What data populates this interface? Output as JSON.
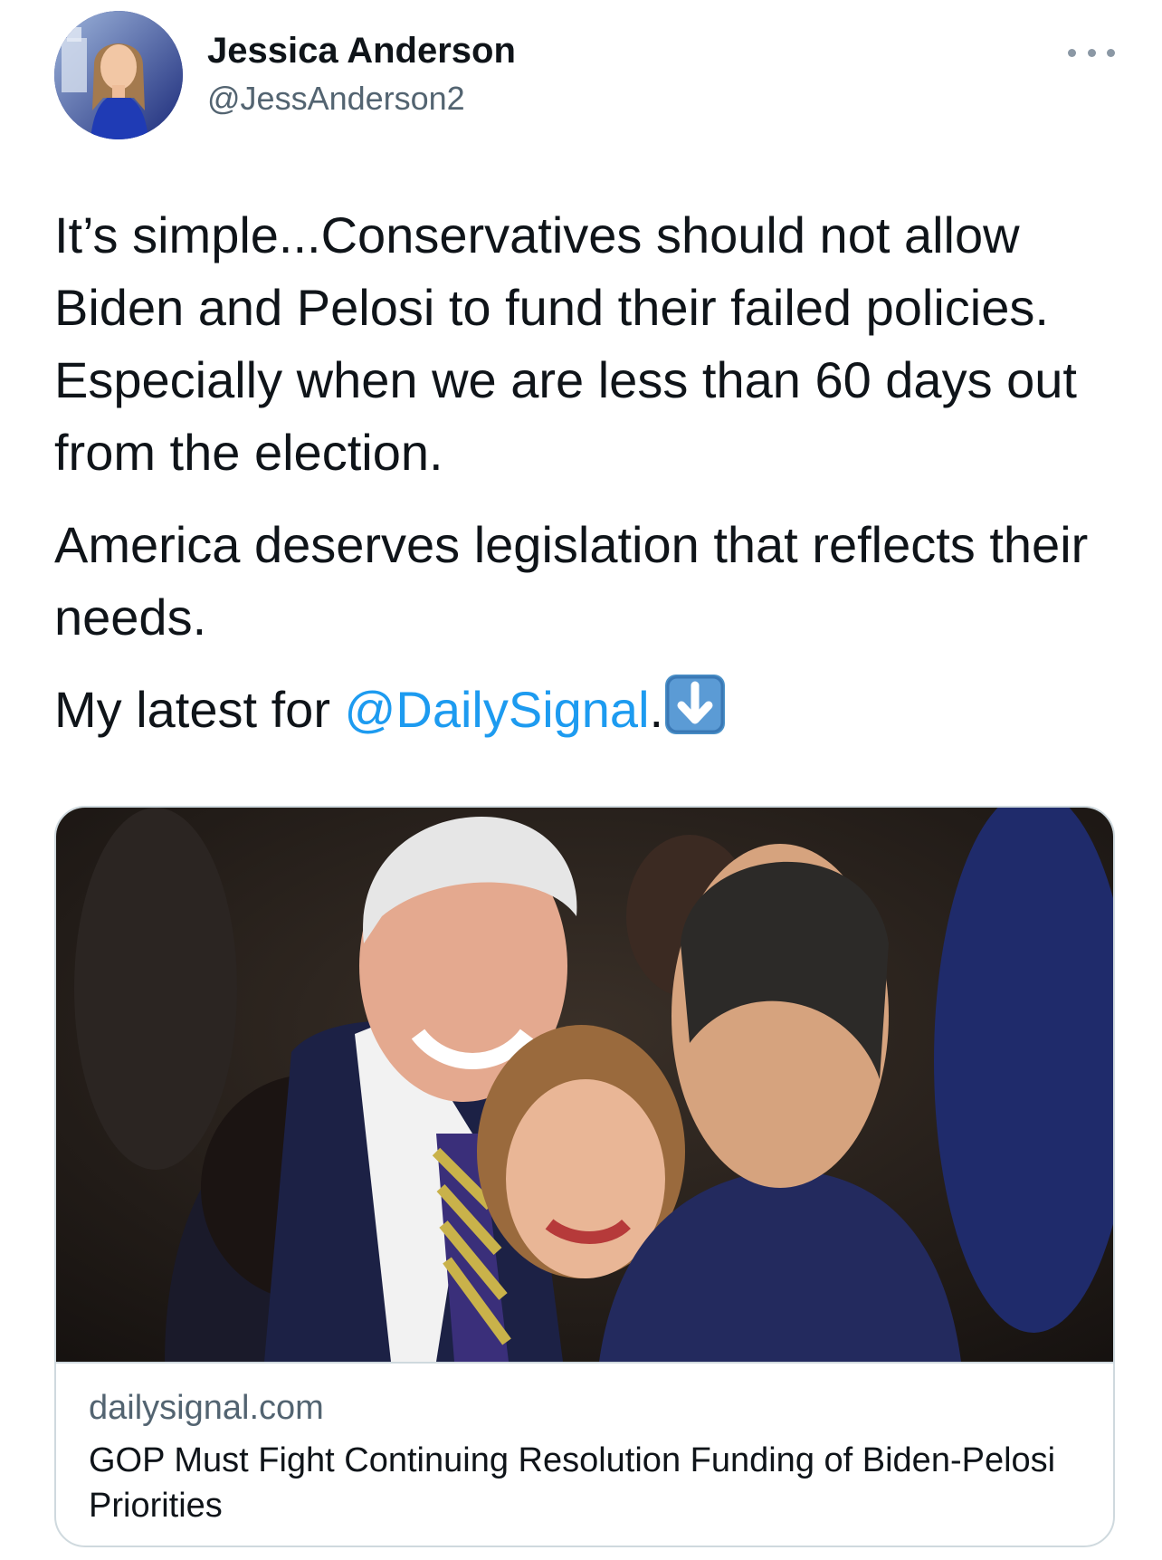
{
  "author": {
    "name": "Jessica Anderson",
    "handle": "@JessAnderson2",
    "avatar_icon": "profile-photo"
  },
  "tweet": {
    "paragraph1": "It’s simple...Conservatives should not allow Biden and Pelosi to fund their failed policies. Especially when we are less than 60 days out from the election.",
    "paragraph2": "America deserves legislation that reflects their needs.",
    "paragraph3_prefix": "My latest for ",
    "mention": "@DailySignal",
    "paragraph3_suffix": ".",
    "emoji": "down-arrow-emoji"
  },
  "card": {
    "domain": "dailysignal.com",
    "title": "GOP Must Fight Continuing Resolution Funding of Biden-Pelosi Priorities",
    "image": "photo-of-politicians"
  },
  "colors": {
    "link": "#1d9bf0",
    "secondary_text": "#536471",
    "border": "#cfd9de"
  }
}
